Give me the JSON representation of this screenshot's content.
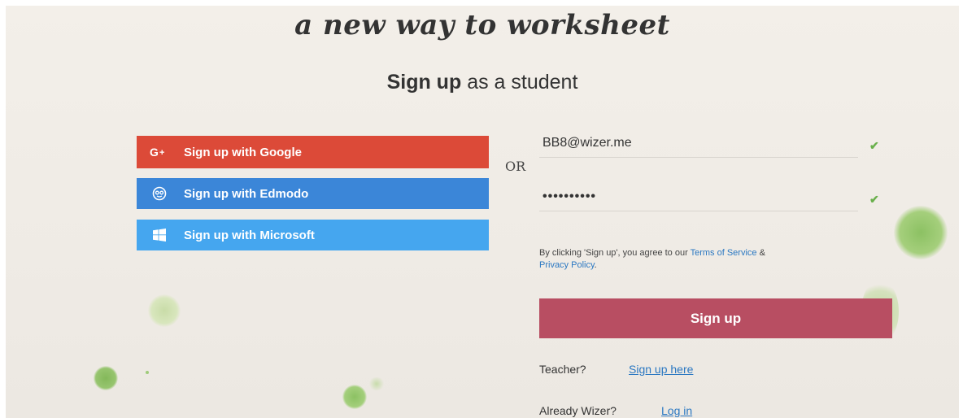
{
  "tagline": "a new way to worksheet",
  "heading": {
    "bold": "Sign up",
    "rest": "as a student"
  },
  "social": {
    "google": {
      "label": "Sign up with Google",
      "icon": "google-plus-icon"
    },
    "edmodo": {
      "label": "Sign up with Edmodo",
      "icon": "edmodo-icon"
    },
    "microsoft": {
      "label": "Sign up with Microsoft",
      "icon": "windows-icon"
    }
  },
  "or_label": "OR",
  "form": {
    "email_value": "BB8@wizer.me",
    "password_value": "••••••••••",
    "check_icon": "check-icon"
  },
  "terms": {
    "prefix": "By clicking 'Sign up', you agree to our ",
    "terms_link": "Terms of Service",
    "amp": " & ",
    "privacy_link": "Privacy Policy",
    "suffix": "."
  },
  "signup_button": "Sign up",
  "teacher": {
    "label": "Teacher?",
    "link": "Sign up here"
  },
  "wizer": {
    "label": "Already Wizer?",
    "link": "Log in"
  },
  "colors": {
    "google": "#dc4a38",
    "edmodo": "#3b86d8",
    "microsoft": "#45a6ef",
    "signup": "#b84e62",
    "link": "#2b78c2",
    "check": "#6ab04c"
  }
}
